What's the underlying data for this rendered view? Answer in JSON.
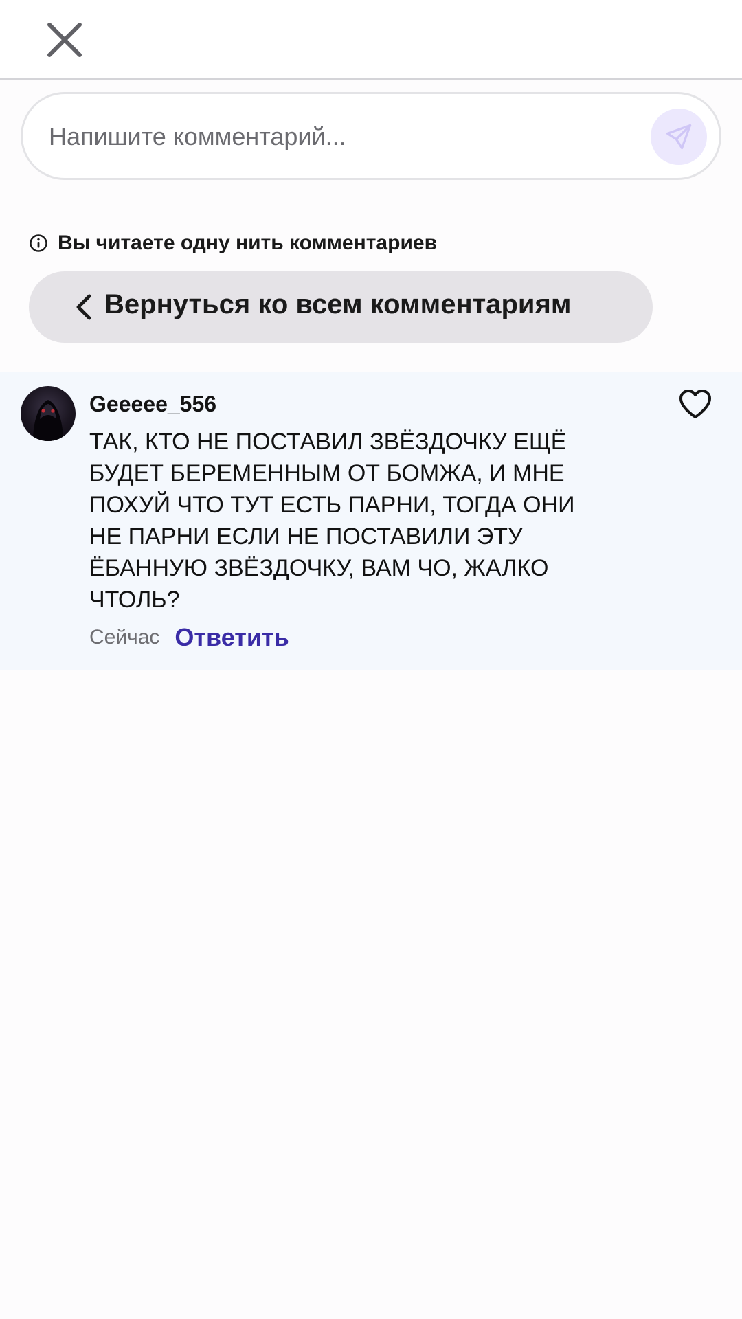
{
  "header": {
    "close_icon": "close-icon"
  },
  "composer": {
    "placeholder": "Напишите комментарий...",
    "value": "",
    "send_icon": "send-icon",
    "send_button_bg": "#ece8fd"
  },
  "thread_notice": {
    "icon": "info-icon",
    "label": "Вы читаете одну нить комментариев"
  },
  "back_button": {
    "icon": "chevron-left-icon",
    "label": "Вернуться ко всем комментариям"
  },
  "comment": {
    "author": "Geeeee_556",
    "avatar": "avatar",
    "text_lines": [
      "ТАК, КТО НЕ ПОСТАВИЛ ЗВЁЗДОЧКУ ЕЩЁ",
      "БУДЕТ БЕРЕМЕННЫМ ОТ БОМЖА, И МНЕ",
      "ПОХУЙ ЧТО ТУТ ЕСТЬ ПАРНИ, ТОГДА ОНИ",
      "НЕ ПАРНИ ЕСЛИ НЕ ПОСТАВИЛИ ЭТУ",
      "ЁБАННУЮ ЗВЁЗДОЧКУ, ВАМ ЧО, ЖАЛКО",
      "ЧТОЛЬ?"
    ],
    "time": "Сейчас",
    "reply_label": "Ответить",
    "like_icon": "heart-icon",
    "reply_color": "#3a2ca6",
    "highlight_bg": "#f4f8fd"
  }
}
